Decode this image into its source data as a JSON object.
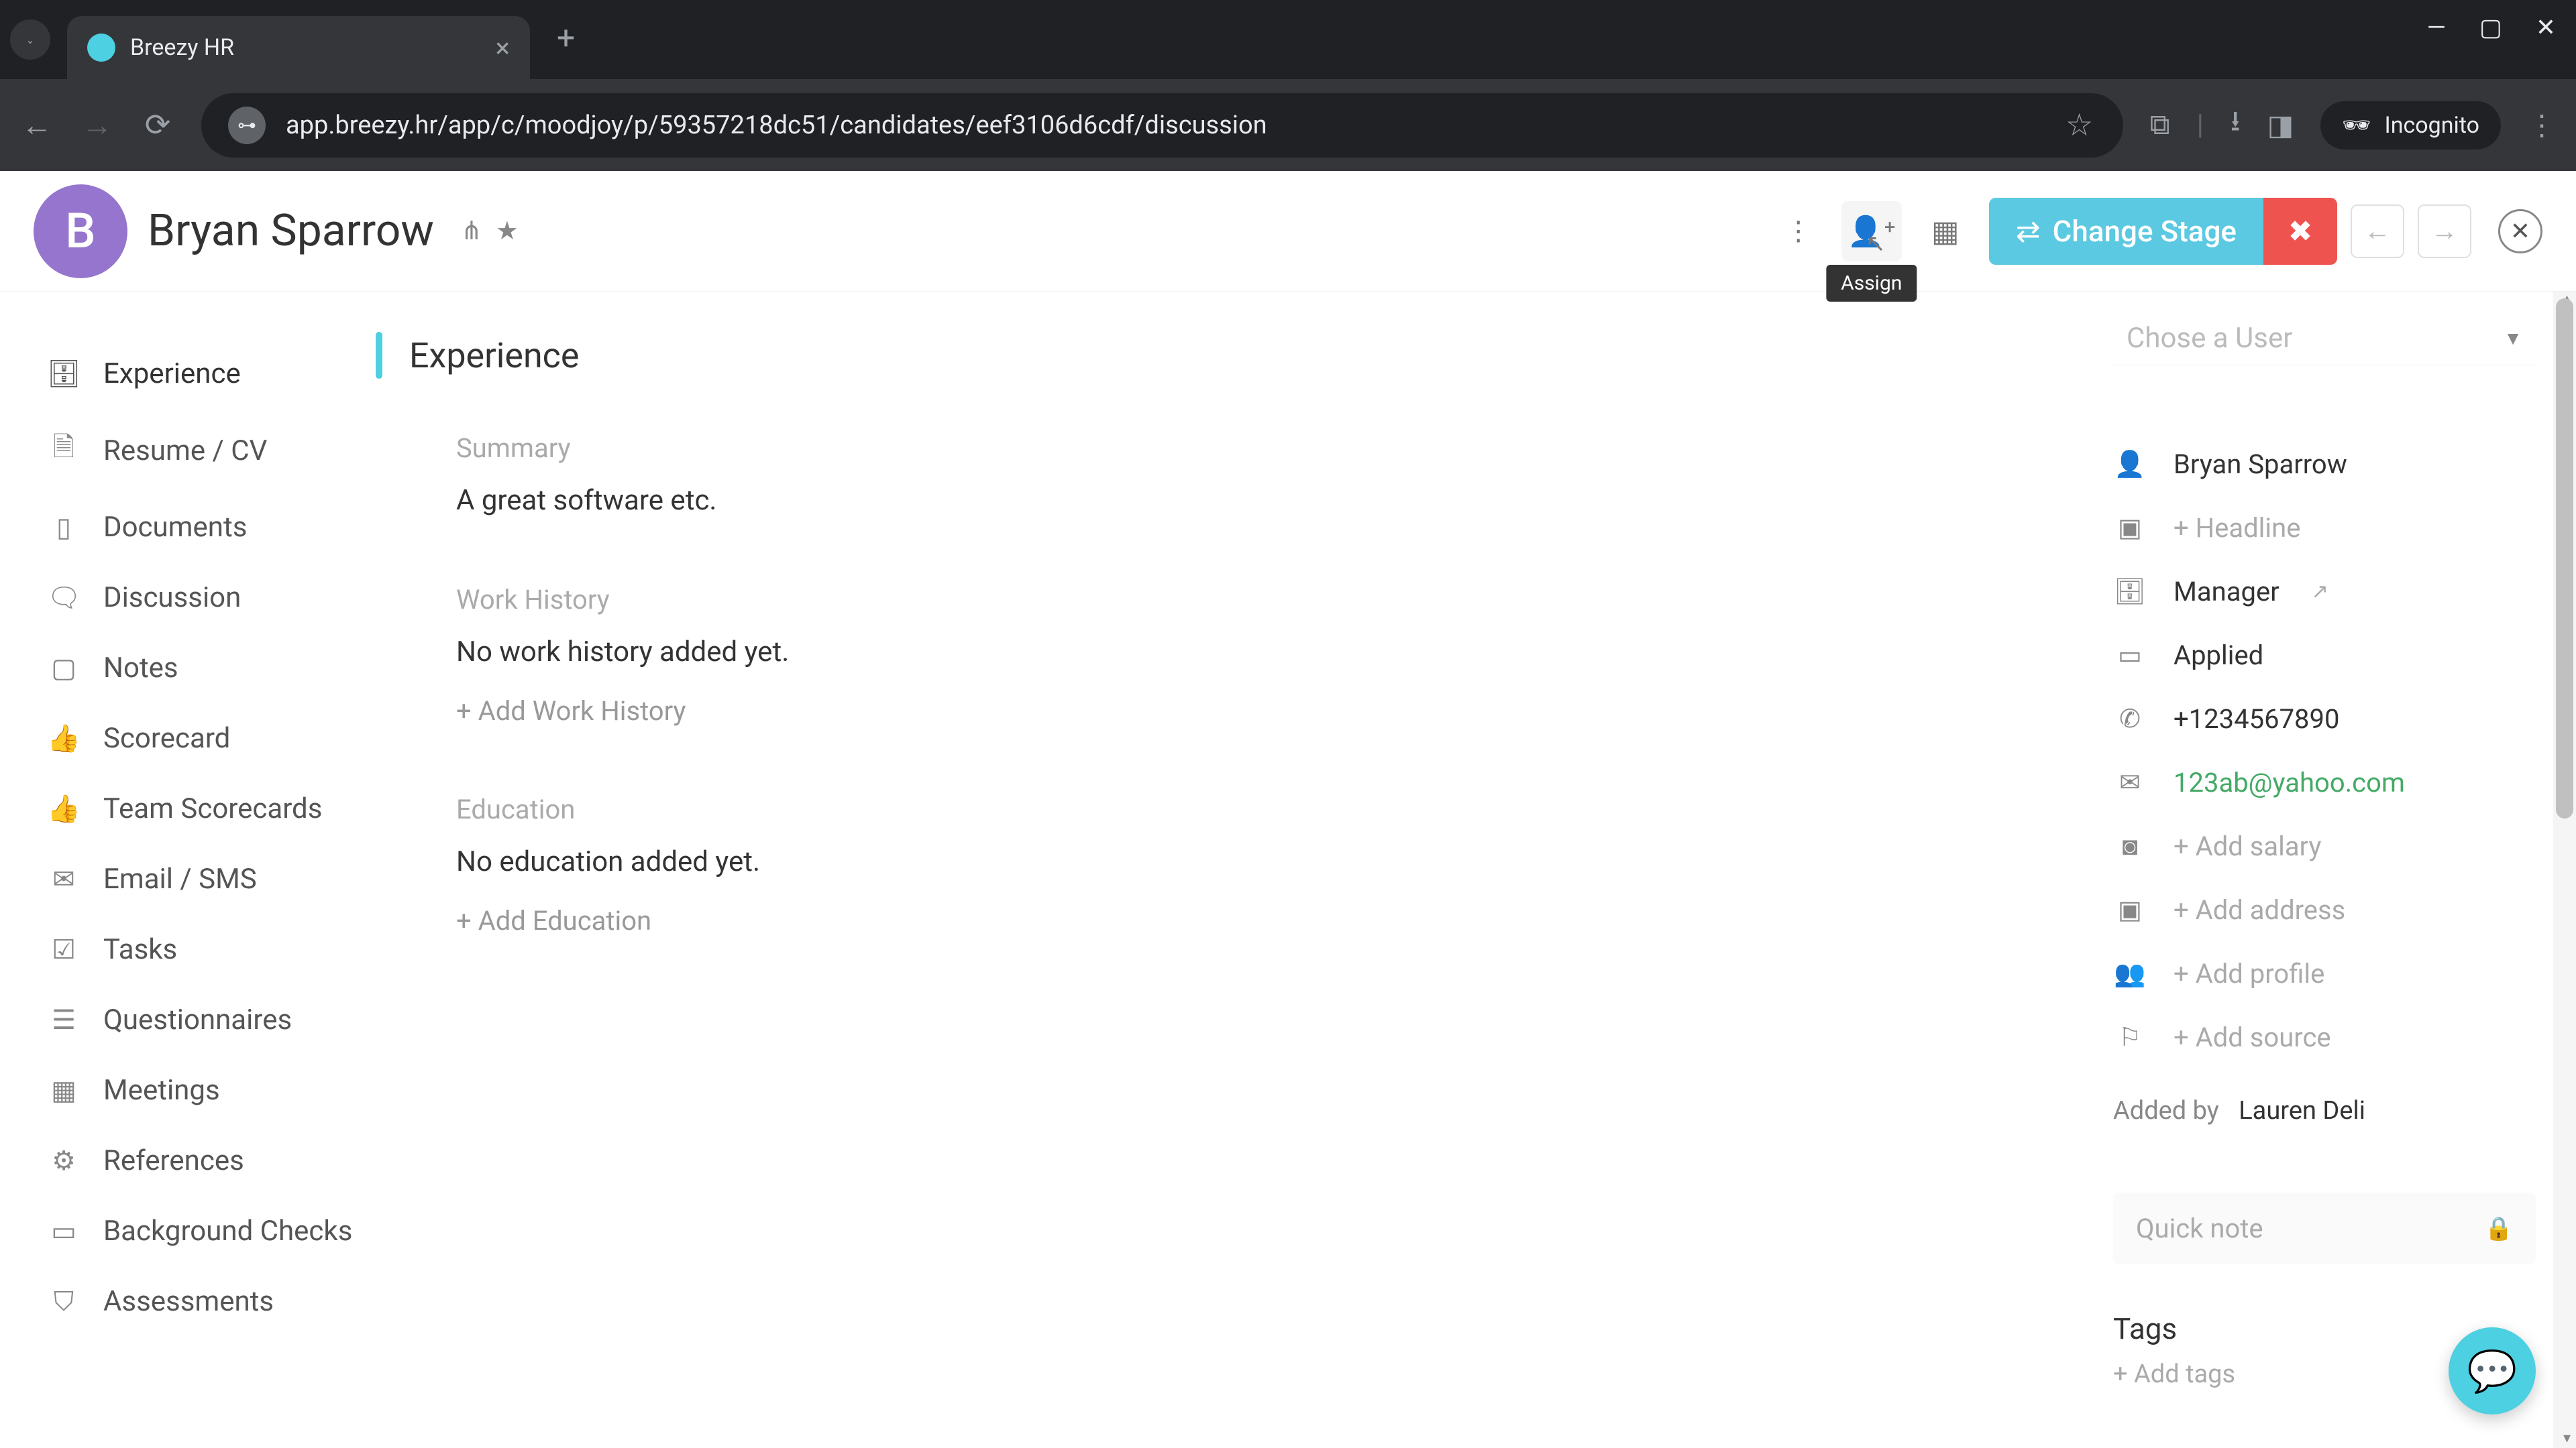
{
  "browser": {
    "tab_title": "Breezy HR",
    "url": "app.breezy.hr/app/c/moodjoy/p/59357218dc51/candidates/eef3106d6cdf/discussion",
    "incognito_label": "Incognito"
  },
  "header": {
    "avatar_letter": "B",
    "candidate_name": "Bryan Sparrow",
    "change_stage_label": "Change Stage",
    "assign_tooltip": "Assign"
  },
  "sidebar": {
    "items": [
      {
        "label": "Experience",
        "icon": "briefcase"
      },
      {
        "label": "Resume / CV",
        "icon": "file"
      },
      {
        "label": "Documents",
        "icon": "doc"
      },
      {
        "label": "Discussion",
        "icon": "chat"
      },
      {
        "label": "Notes",
        "icon": "note"
      },
      {
        "label": "Scorecard",
        "icon": "thumbs"
      },
      {
        "label": "Team Scorecards",
        "icon": "thumbs"
      },
      {
        "label": "Email / SMS",
        "icon": "mail"
      },
      {
        "label": "Tasks",
        "icon": "check"
      },
      {
        "label": "Questionnaires",
        "icon": "list"
      },
      {
        "label": "Meetings",
        "icon": "grid"
      },
      {
        "label": "References",
        "icon": "gear"
      },
      {
        "label": "Background Checks",
        "icon": "card"
      },
      {
        "label": "Assessments",
        "icon": "shield"
      }
    ]
  },
  "main": {
    "section_title": "Experience",
    "summary_label": "Summary",
    "summary_text": "A great software etc.",
    "work_history_label": "Work History",
    "work_history_empty": "No work history added yet.",
    "add_work_history": "+ Add Work History",
    "education_label": "Education",
    "education_empty": "No education added yet.",
    "add_education": "+ Add Education"
  },
  "right": {
    "chose_user_placeholder": "Chose a User",
    "name": "Bryan Sparrow",
    "add_headline": "+ Headline",
    "role": "Manager",
    "status": "Applied",
    "phone": "+1234567890",
    "email": "123ab@yahoo.com",
    "add_salary": "+ Add salary",
    "add_address": "+ Add address",
    "add_profile": "+ Add profile",
    "add_source": "+ Add source",
    "added_by_label": "Added by",
    "added_by_name": "Lauren Deli",
    "quick_note_placeholder": "Quick note",
    "tags_title": "Tags",
    "add_tags": "+ Add tags"
  }
}
